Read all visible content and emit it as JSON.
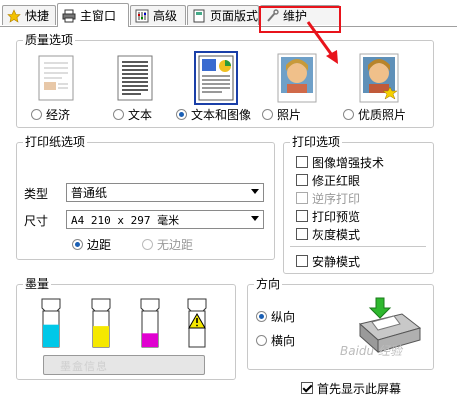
{
  "tabs": [
    {
      "label": "快捷"
    },
    {
      "label": "主窗口"
    },
    {
      "label": "高级"
    },
    {
      "label": "页面版式"
    },
    {
      "label": "维护"
    }
  ],
  "quality": {
    "title": "质量选项",
    "options": [
      {
        "label": "经济",
        "selected": false
      },
      {
        "label": "文本",
        "selected": false
      },
      {
        "label": "文本和图像",
        "selected": true
      },
      {
        "label": "照片",
        "selected": false
      },
      {
        "label": "优质照片",
        "selected": false
      }
    ]
  },
  "paper": {
    "title": "打印纸选项",
    "type_label": "类型",
    "type_value": "普通纸",
    "size_label": "尺寸",
    "size_value": "A4 210 x 297 毫米",
    "margin_label": "边距",
    "borderless_label": "无边距"
  },
  "print_options": {
    "title": "打印选项",
    "items": [
      {
        "label": "图像增强技术",
        "checked": false,
        "disabled": false
      },
      {
        "label": "修正红眼",
        "checked": false,
        "disabled": false
      },
      {
        "label": "逆序打印",
        "checked": false,
        "disabled": true
      },
      {
        "label": "打印预览",
        "checked": false,
        "disabled": false
      },
      {
        "label": "灰度模式",
        "checked": false,
        "disabled": false
      }
    ],
    "quiet_label": "安静模式"
  },
  "ink": {
    "title": "墨量",
    "levels": [
      0.62,
      0.58,
      0.38,
      0.0
    ],
    "colors": [
      "#00c8e8",
      "#f5e800",
      "#e000d0",
      "#222222"
    ],
    "button_label": "墨盒信息"
  },
  "orientation": {
    "title": "方向",
    "portrait_label": "纵向",
    "landscape_label": "横向"
  },
  "first_display_label": "首先显示此屏幕",
  "watermark": "Baidu 经验",
  "colors": {
    "highlight": "#e8131b",
    "radio_dot": "#1a5fb4"
  }
}
